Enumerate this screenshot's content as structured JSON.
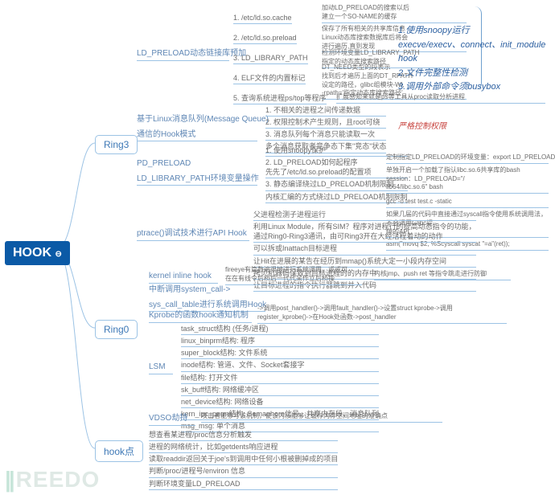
{
  "root": "HOOK",
  "branches": {
    "r3": "Ring3",
    "r0": "Ring0",
    "hp": "hook点"
  },
  "r3": {
    "g1": {
      "hdr": "LD_PRELOAD动态链接库预加",
      "a": "1. /etc/ld.so.cache",
      "a_r": "加动LD_PRELOAD的搜索以后\n建立一个SO-NAME的缓存",
      "b": "2. /etc/ld.so.preload",
      "b_r": "保存了所有相关的共享库信息\nLinux动态库搜索数据库后将会\n进行遍历,直到发现",
      "c": "3. LD_LIBRARY_PATH",
      "c_r": "检测环境变量LD_LIBRARY_PATH\n指定的动态库搜索路径",
      "d": "4. ELF文件的内置标记",
      "d_r": "DT_NEED类型的段表示\n找到后才遍历上面的DT_RPATH\n设定的路径，glibc组模块-Wl,\n-rpath='指定动态库搜索路径'",
      "e": "5. 查询系统进程ps/top等程序",
      "e_r": "扩展感知来就是ps等工具从proc读取分析进程"
    },
    "g2": {
      "hdr1": "基于Linux消息队列(Message Queue)",
      "hdr2": "通信的Hook模式",
      "a": "1. 不相关的进程之间传递数据",
      "b": "2. 权限控制术产生规则，且root可绕",
      "c": "3. 消息队列每个消息只能读取一次",
      "d": "多个消息获取者竞争态下集\"竞态\"状态",
      "annot": "严格控制权限"
    },
    "g3": {
      "hdr1": "PD_PRELOAD",
      "hdr2": "LD_LIBRARY_PATH环境变量操作",
      "a": "1. 使用snoopy保护",
      "b": "2. LD_PRELOAD如何起程序\n    先先了/etc/ld.so.preload的配置项",
      "b_r1": "定制指定LD_PRELOAD的环境变量：export LD_PRELOAD=lib64/libc.so.6",
      "b_r2": "单独开启一个加载了指认libc.so.6共享库的bash session：LD_PRELOAD=\"/\nlib64/libc.so.6\" bash",
      "c": "3. 静态编译绕过LD_PRELOAD机制限制",
      "c_r": "gcc -o test test.c -static",
      "d": "内核汇编的方式绕过LD_PRELOAD机制限制",
      "d_r1": "如果几届的代码中直接通过syscall指令使用系统调用法，不会调用Glibc提\n供的API",
      "d_r2": "asm(\"movq  $2, %Scyscall syscat \"=a\"(ret));"
    },
    "g4": {
      "hdr": "ptrace()调试技术进行API Hook",
      "a": "父进程检测子进程运行",
      "b": "利用Linux Module，所有SIM？程序对进程行的提高动态指令的功能，\n通过Ring0-Ring3通讯，由可Ring3开在大经活程着动的动作",
      "c": "可以拆或Inattach目标进程",
      "d": "让Hit在进展的某告在经历到mmap()系统大定一小段内存空间",
      "e": "拷贝机器码保致到目标进程的的内存中",
      "f": "让目标进程的指令执行器跳到并入代码"
    }
  },
  "r0": {
    "g1": {
      "hdr": "kernel inline hook",
      "r1": "fireeye有篇数遍很地进行系统调用，或或可\n在在有线令后桥后一代代呆作立后桥操",
      "r2": "内核jmp、push ret 等指令跳走进行防御"
    },
    "g2": {
      "hdr1": "中断调用system_call->",
      "hdr2": "sys_call_table进行系统调用Hook"
    },
    "g3": {
      "hdr": "Kprobe的函数hook通知机制",
      "r": "->调用post_handler()->调用fault_handler()->设置struct kprobe->调用\nregister_kprobe()->在Hook处函数->post_handler"
    },
    "g4": {
      "hdr": "LSM",
      "a": "task_struct结构 (任务/进程)",
      "b": "linux_binprm结构: 程序",
      "c": "super_block结构: 文件系统",
      "d": "inode结构: 管道、文件、Socket套接字",
      "e": "file结构: 打开文件",
      "f": "sk_buff结构: 网络缓冲区",
      "g": "net_device结构: 网络设备",
      "h": "kern_ipc_perm结构: Semaphore信号、共享内存段、消息队列",
      "i": "msg_msg: 单个消息"
    },
    "g5": {
      "hdr": "VDSO劫持",
      "r": "攻击者能够写该机制，使该内核能够让缓存内存空间地址的准确点"
    }
  },
  "hp": {
    "a": "想查看某进程/proc信息分析触发",
    "b": "进程的网络统计，比如getdents响应进程",
    "c": "读取readdir返回关于joe's到调用中任何小根被删掉成的项目",
    "d": "判断/proc/进程号/environ 信息",
    "e": "判断环境变量LD_PRELOAD"
  },
  "rightNote": {
    "l1": "1.使用snoopy运行",
    "l2": "execve/execv、connect、init_module hook",
    "l3": "2.文件完整性检测",
    "l4": "3.调用外部命令须busybox"
  },
  "watermark": "REEDO"
}
